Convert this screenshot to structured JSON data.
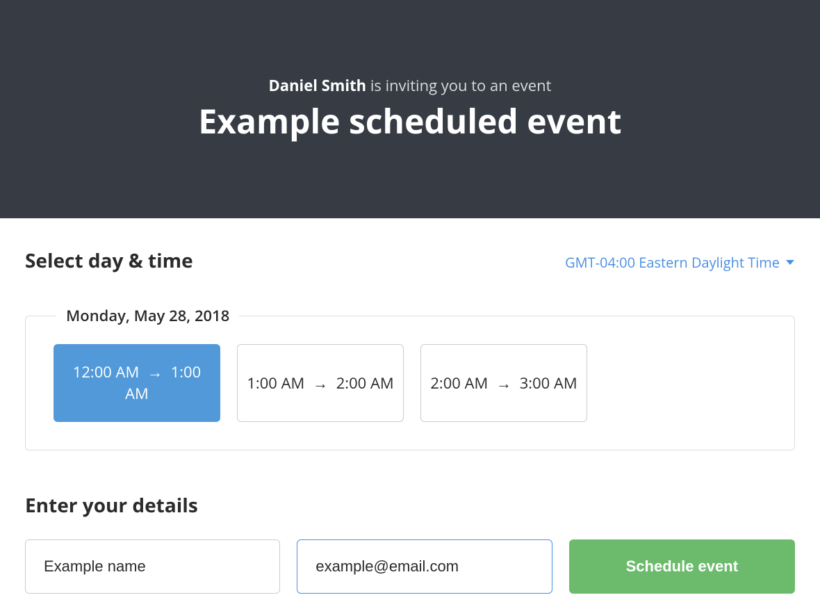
{
  "header": {
    "inviter_name": "Daniel Smith",
    "invite_suffix": " is inviting you to an event",
    "event_title": "Example scheduled event"
  },
  "select": {
    "heading": "Select day & time",
    "timezone_label": "GMT-04:00 Eastern Daylight Time",
    "date_label": "Monday, May 28, 2018",
    "slots": [
      {
        "start": "12:00 AM",
        "end": "1:00 AM",
        "selected": true
      },
      {
        "start": "1:00 AM",
        "end": "2:00 AM",
        "selected": false
      },
      {
        "start": "2:00 AM",
        "end": "3:00 AM",
        "selected": false
      }
    ]
  },
  "details": {
    "heading": "Enter your details",
    "name_value": "Example name",
    "email_value": "example@email.com",
    "submit_label": "Schedule event"
  },
  "glyphs": {
    "arrow_right": "→"
  }
}
